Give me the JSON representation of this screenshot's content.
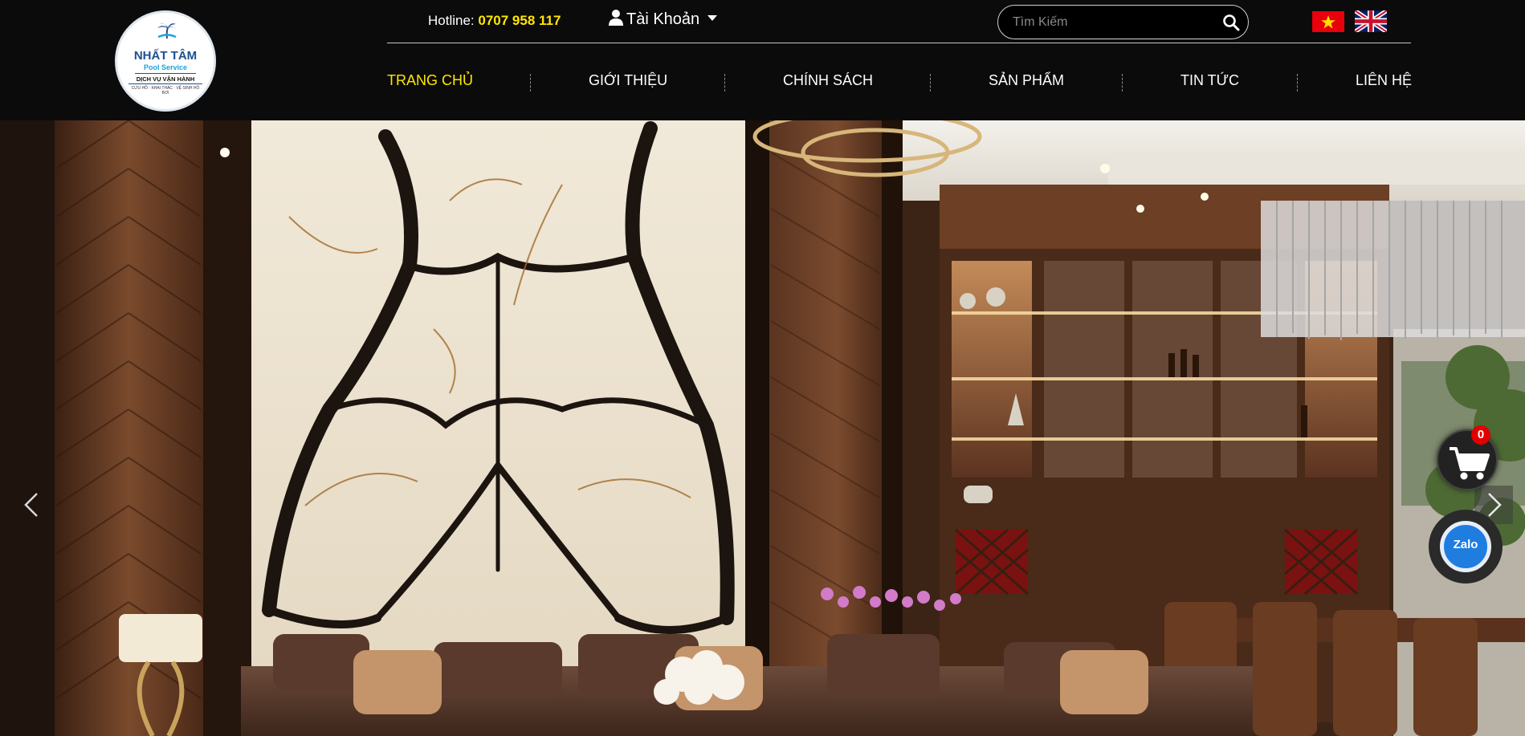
{
  "brand": {
    "name": "NHẤT TÂM",
    "subtitle": "Pool Service",
    "service": "DỊCH VỤ VẬN HÀNH",
    "tagline": "CỨU HỒ · KHAI THÁC · VỆ SINH HỒ BƠI",
    "colors": {
      "primary": "#1d4f8f",
      "accent": "#1aa3dd"
    }
  },
  "topbar": {
    "hotline_label": "Hotline:",
    "hotline_number": "0707 958 117",
    "account_label": "Tài Khoản",
    "account_icon": "user-icon"
  },
  "search": {
    "placeholder": "Tìm Kiếm",
    "value": "",
    "icon": "search-icon"
  },
  "languages": [
    {
      "code": "vi",
      "icon": "vietnam-flag-icon"
    },
    {
      "code": "en",
      "icon": "uk-flag-icon"
    }
  ],
  "nav": {
    "items": [
      {
        "label": "TRANG CHỦ",
        "active": true
      },
      {
        "label": "GIỚI THIỆU",
        "active": false
      },
      {
        "label": "CHÍNH SÁCH",
        "active": false
      },
      {
        "label": "SẢN PHẨM",
        "active": false
      },
      {
        "label": "TIN TỨC",
        "active": false
      },
      {
        "label": "LIÊN HỆ",
        "active": false
      }
    ]
  },
  "hero": {
    "image": "luxury-living-room-interior-photo"
  },
  "cart": {
    "count": "0",
    "icon": "cart-icon"
  },
  "zalo": {
    "label": "Zalo"
  },
  "colors": {
    "header_bg": "#0b0b0b",
    "active_nav": "#ffe600",
    "badge": "#e10000",
    "zalo": "#1f7de0"
  }
}
